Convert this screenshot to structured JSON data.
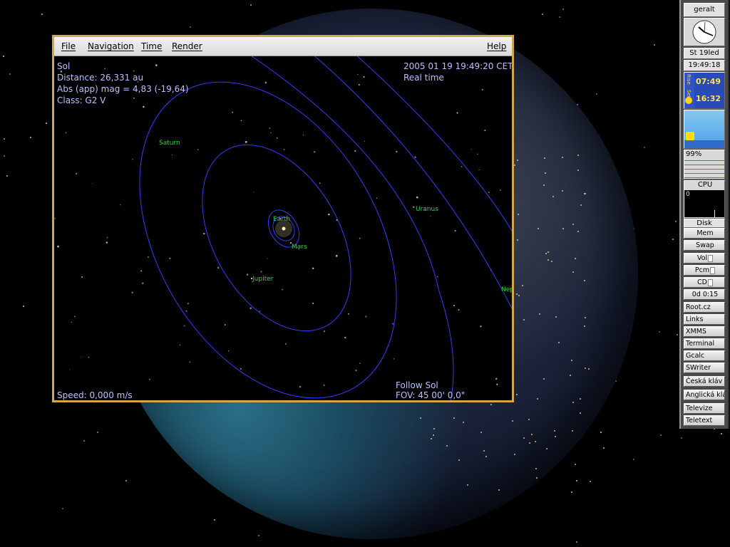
{
  "window": {
    "menu": {
      "file": "File",
      "navigation": "Navigation",
      "time": "Time",
      "render": "Render",
      "help": "Help"
    },
    "hud": {
      "object_name": "Sol",
      "distance": "Distance: 26,331 au",
      "magnitude": "Abs (app) mag = 4,83 (-19,64)",
      "class": "Class: G2 V",
      "datetime": "2005 01 19 19:49:20 CET",
      "time_mode": "Real time",
      "speed": "Speed: 0,000 m/s",
      "follow": "Follow  Sol",
      "fov": "FOV: 45 00' 0,0\""
    },
    "planets": {
      "earth": "Earth",
      "mars": "Mars",
      "jupiter": "Jupiter",
      "saturn": "Saturn",
      "uranus": "Uranus",
      "neptune": "Nep"
    },
    "colors": {
      "orbit": "#2f3cff",
      "label": "#32d13a",
      "hud_text": "#b8c0ff",
      "window_border": "#d6a548"
    }
  },
  "dock": {
    "user": "geralt",
    "date": "St  19led",
    "time": "19:49:18",
    "sunrise": "07:49",
    "sunset": "16:32",
    "sun_rise_label": "Rise",
    "sun_set_label": "Set",
    "battery": "99%",
    "cpu_label": "CPU",
    "cpu_value": "0",
    "disk_label": "Disk",
    "mem_label": "Mem",
    "swap_label": "Swap",
    "vol_label": "Vol",
    "pcm_label": "Pcm",
    "cd_label": "CD",
    "uptime": "0d  0:15",
    "launchers": [
      "Root.cz",
      "Links",
      "XMMS",
      "Terminal",
      "Gcalc",
      "SWriter",
      "Česká kláv",
      "Anglická kláv",
      "Televize",
      "Teletext"
    ]
  }
}
